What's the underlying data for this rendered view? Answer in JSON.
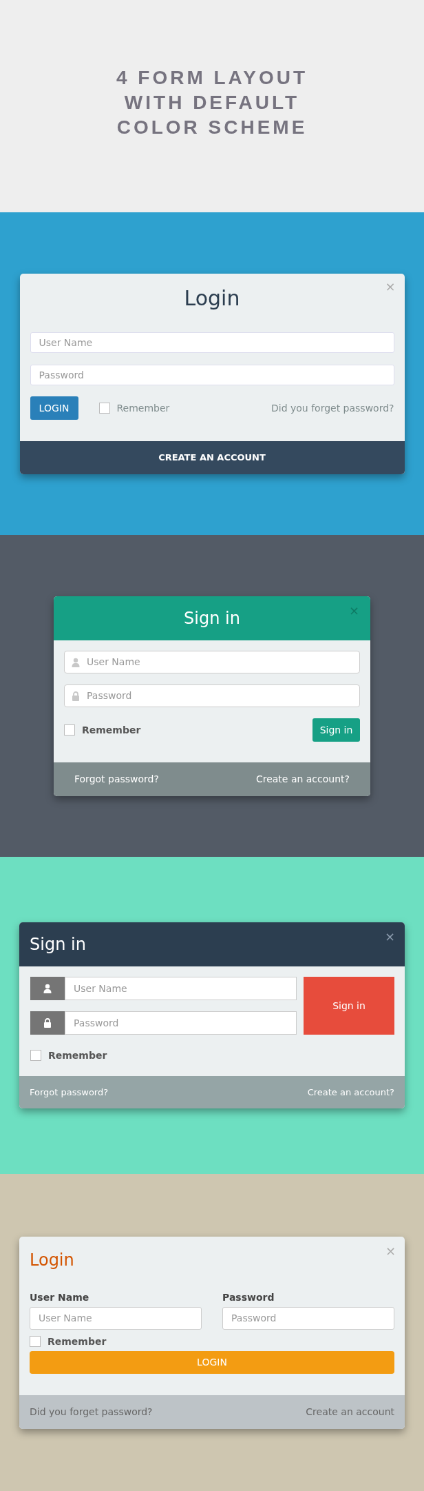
{
  "banner": {
    "lines": [
      "4 FORM LAYOUT",
      "WITH DEFAULT",
      "COLOR SCHEME"
    ]
  },
  "forms": [
    {
      "kind": "classic",
      "title": "Login",
      "close": "×",
      "fields": [
        {
          "placeholder": "User Name"
        },
        {
          "placeholder": "Password"
        }
      ],
      "submit": "LOGIN",
      "remember": {
        "label": "Remember",
        "checked": false
      },
      "links": [
        "Did you forget password?"
      ],
      "footer": [
        "CREATE AN ACCOUNT"
      ]
    },
    {
      "kind": "header",
      "title": "Sign in",
      "close": "×",
      "fields": [
        {
          "placeholder": "User Name"
        },
        {
          "placeholder": "Password"
        }
      ],
      "submit": "Sign in",
      "remember": {
        "label": "Remember",
        "checked": false
      },
      "footer": [
        "Forgot password?",
        "Create an account?"
      ]
    },
    {
      "kind": "addon",
      "title": "Sign in",
      "close": "×",
      "fields": [
        {
          "placeholder": "User Name"
        },
        {
          "placeholder": "Password"
        }
      ],
      "submit": "Sign in",
      "remember": {
        "label": "Remember",
        "checked": false
      },
      "footer": [
        "Forgot password?",
        "Create an account?"
      ]
    },
    {
      "kind": "stacked",
      "title": "Login",
      "close": "×",
      "fields": [
        {
          "label": "User Name",
          "placeholder": "User Name"
        },
        {
          "label": "Password",
          "placeholder": "Password"
        }
      ],
      "submit": "LOGIN",
      "remember": {
        "label": "Remember",
        "checked": false
      },
      "footer": [
        "Did you forget password?",
        "Create an account"
      ]
    }
  ]
}
